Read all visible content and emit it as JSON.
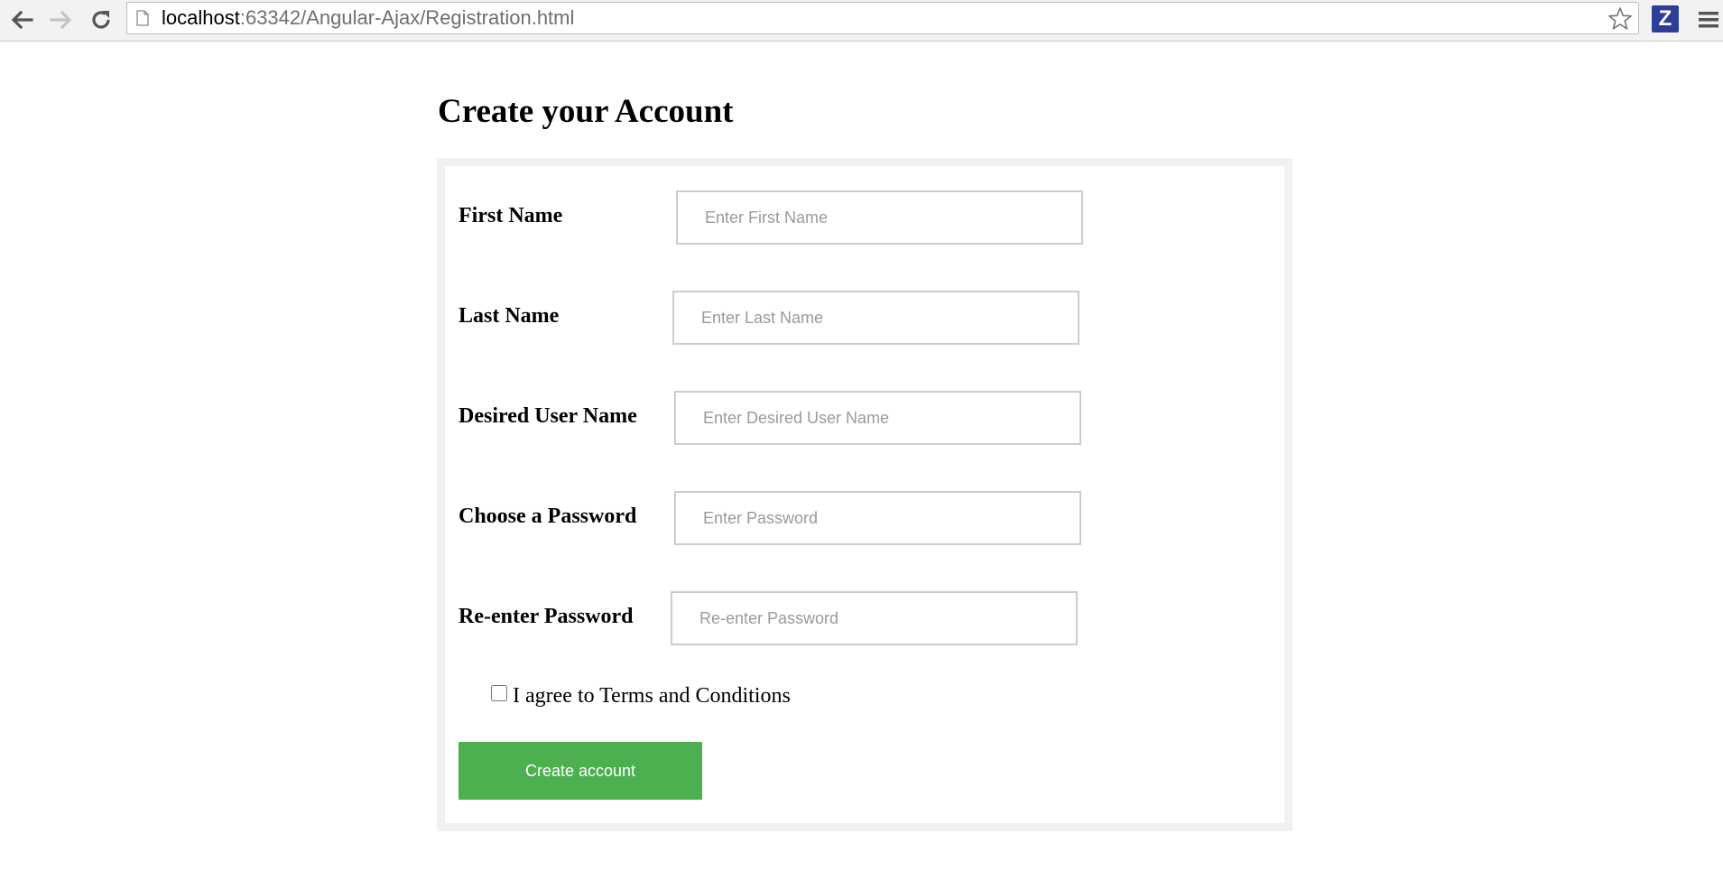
{
  "browser": {
    "url_host": "localhost",
    "url_rest": ":63342/Angular-Ajax/Registration.html",
    "extension_letter": "Z",
    "icons": {
      "back": "back-arrow-icon",
      "forward": "forward-arrow-icon",
      "reload": "reload-icon",
      "page": "page-document-icon",
      "bookmark": "star-icon",
      "extension": "z-extension-icon",
      "menu": "hamburger-menu-icon"
    }
  },
  "form": {
    "title": "Create your Account",
    "fields": [
      {
        "label": "First Name",
        "placeholder": "Enter First Name",
        "value": ""
      },
      {
        "label": "Last Name",
        "placeholder": "Enter Last Name",
        "value": ""
      },
      {
        "label": "Desired User Name",
        "placeholder": "Enter Desired User Name",
        "value": ""
      },
      {
        "label": "Choose a Password",
        "placeholder": "Enter Password",
        "value": ""
      },
      {
        "label": "Re-enter Password",
        "placeholder": "Re-enter Password",
        "value": ""
      }
    ],
    "agree_label": "I agree to Terms and Conditions",
    "agree_checked": false,
    "submit_label": "Create account"
  },
  "colors": {
    "submit_button": "#4caf50",
    "form_border": "#f1f1f1",
    "extension_bg": "#2f3d9a"
  }
}
